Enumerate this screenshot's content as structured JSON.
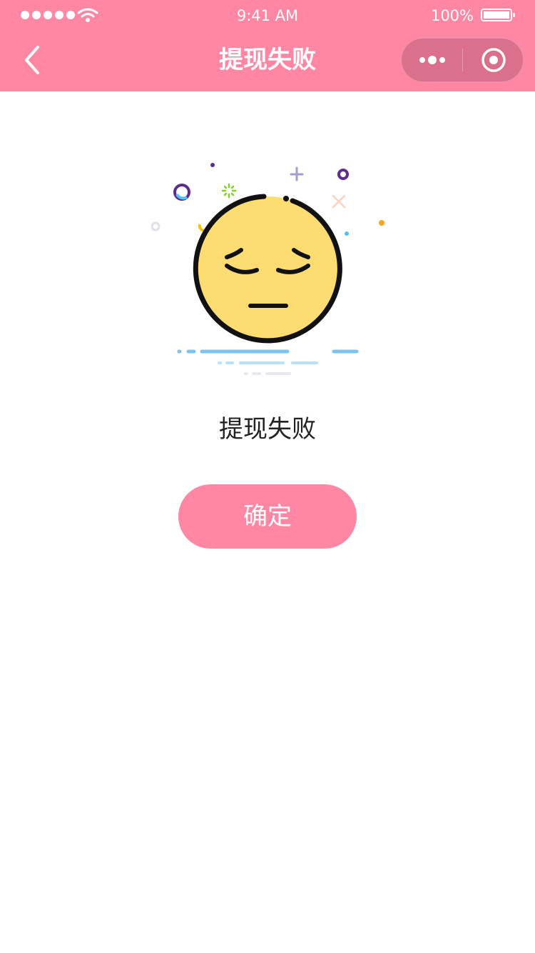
{
  "status_bar": {
    "time": "9:41 AM",
    "battery": "100%",
    "signal_icon": "signal-dots-icon",
    "wifi_icon": "wifi-icon",
    "battery_icon": "battery-icon"
  },
  "nav": {
    "title": "提现失败",
    "back_icon": "chevron-left-icon",
    "more_icon": "more-dots-icon",
    "close_icon": "target-circle-icon"
  },
  "content": {
    "illustration": "sad-face-icon",
    "message": "提现失败",
    "confirm_label": "确定"
  },
  "colors": {
    "primary": "#ff87a3",
    "face": "#fddc72",
    "text": "#222222"
  }
}
